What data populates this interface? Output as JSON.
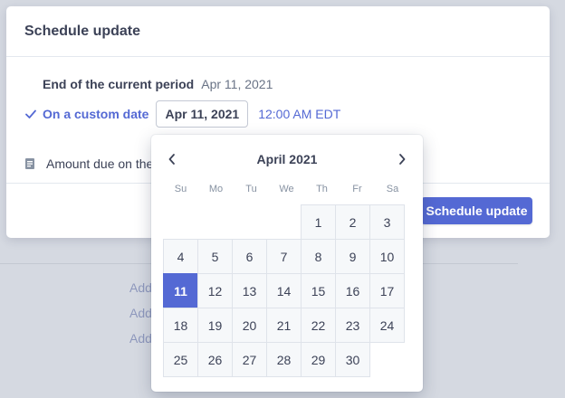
{
  "background": {
    "links": [
      "Add",
      "Add",
      "Add"
    ]
  },
  "modal": {
    "title": "Schedule update",
    "end_period_label": "End of the current period",
    "end_period_date": "Apr 11, 2021",
    "custom_date_label": "On a custom date",
    "date_input_value": "Apr 11, 2021",
    "time_value": "12:00 AM EDT",
    "amount_due_label": "Amount due on the",
    "schedule_button": "Schedule update"
  },
  "icons": {
    "check": "check-icon",
    "document": "document-icon",
    "prev": "chevron-left-icon",
    "next": "chevron-right-icon"
  },
  "calendar": {
    "month_label": "April 2021",
    "weekdays": [
      "Su",
      "Mo",
      "Tu",
      "We",
      "Th",
      "Fr",
      "Sa"
    ],
    "selected_day": "11",
    "weeks": [
      [
        "",
        "",
        "",
        "",
        "1",
        "2",
        "3"
      ],
      [
        "4",
        "5",
        "6",
        "7",
        "8",
        "9",
        "10"
      ],
      [
        "11",
        "12",
        "13",
        "14",
        "15",
        "16",
        "17"
      ],
      [
        "18",
        "19",
        "20",
        "21",
        "22",
        "23",
        "24"
      ],
      [
        "25",
        "26",
        "27",
        "28",
        "29",
        "30",
        ""
      ]
    ]
  },
  "colors": {
    "accent": "#5469d4",
    "overlay": "#d5d9e1",
    "text": "#3c4257",
    "muted": "#697386"
  }
}
